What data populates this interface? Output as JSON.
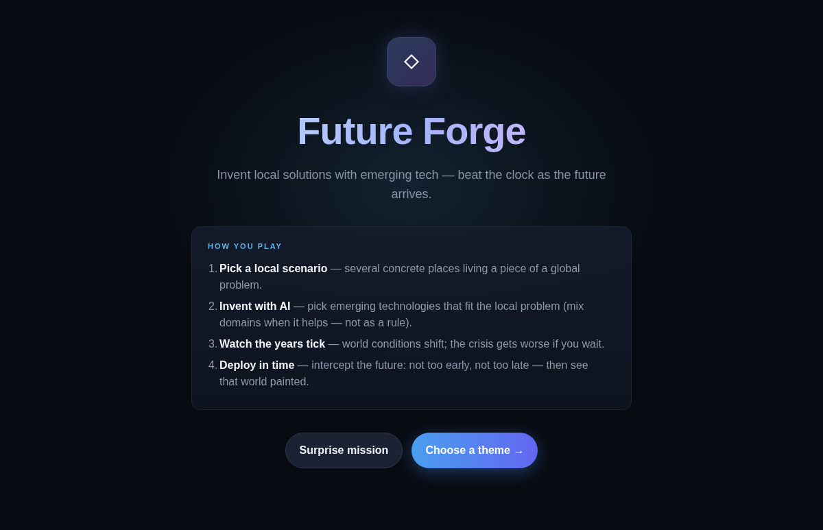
{
  "title": "Future Forge",
  "tagline": "Invent local solutions with emerging tech — beat the clock as the future arrives.",
  "how_to_play": {
    "heading": "HOW YOU PLAY",
    "steps": [
      {
        "number": "1.",
        "text": "**Pick a local scenario** — several concrete places living a piece of a global problem."
      },
      {
        "number": "2.",
        "text": "**Invent with AI** — pick emerging technologies that fit the local problem (mix domains when it helps — not as a rule)."
      },
      {
        "number": "3.",
        "text": "**Watch the years tick** — world conditions shift; the crisis gets worse if you wait."
      },
      {
        "number": "4.",
        "text": "**Deploy in time** — intercept the future: not too early, not too late — then see that world painted."
      }
    ]
  },
  "buttons": [
    {
      "label": "Surprise mission",
      "kind": "secondary"
    },
    {
      "label": "Choose a theme →",
      "kind": "primary"
    }
  ]
}
